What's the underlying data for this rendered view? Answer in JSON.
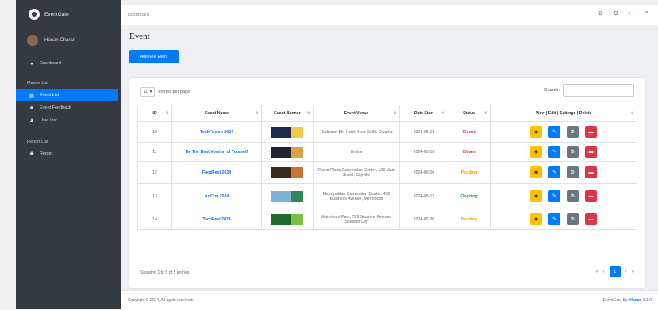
{
  "brand": {
    "name": "EventGate"
  },
  "user": {
    "name": "Hanan Charan"
  },
  "nav": {
    "dashboard": "Dashboard",
    "section1": "Master List",
    "items1": [
      {
        "label": "Event List",
        "icon": "calendar-icon",
        "active": true
      },
      {
        "label": "Event Feedback",
        "icon": "users-icon",
        "active": false
      },
      {
        "label": "User List",
        "icon": "user-icon",
        "active": false
      }
    ],
    "section2": "Report List",
    "items2": [
      {
        "label": "Report",
        "icon": "gear-icon"
      }
    ]
  },
  "topbar": {
    "breadcrumb": "Dashboard",
    "icons": [
      "grid-icon",
      "gear-icon",
      "logout-icon",
      "menu-icon"
    ]
  },
  "page": {
    "title": "Event",
    "add_button": "Add New Event"
  },
  "table": {
    "length_value": "10",
    "length_label": "entries per page",
    "search_label": "Search:",
    "columns": [
      "ID",
      "Event Name",
      "Event Banner",
      "Event Venue",
      "Date Start",
      "Status",
      "View | Edit | Settings | Delete"
    ],
    "rows": [
      {
        "id": "10",
        "name": "TechFusion 2024",
        "venue": "Radisson Blu Hotel, New Delhi, Dwarka",
        "date": "2024-05-18",
        "status": "Closed",
        "status_color": "#dc3545",
        "banner_colors": [
          "#1e2a4a",
          "#f2c94c"
        ]
      },
      {
        "id": "11",
        "name": "Be The Best Version of Yourself",
        "venue": "Online",
        "date": "2024-05-18",
        "status": "Closed",
        "status_color": "#dc3545",
        "banner_colors": [
          "#20242c",
          "#d9a441"
        ]
      },
      {
        "id": "12",
        "name": "FoodFest 2024",
        "venue": "Grand Plaza Convention Center, 123 Main Street, Cityville",
        "date": "2024-06-06",
        "status": "Pending",
        "status_color": "#fd9f17",
        "banner_colors": [
          "#3b2a1a",
          "#c7742e"
        ]
      },
      {
        "id": "13",
        "name": "ArtCon 2024",
        "venue": "Metropolitan Convention Center, 456 Business Avenue, Metropolis",
        "date": "2024-05-12",
        "status": "Ongoing",
        "status_color": "#28a745",
        "banner_colors": [
          "#7fb3d5",
          "#2e8b57"
        ]
      },
      {
        "id": "14",
        "name": "TechFest 2024",
        "venue": "Waterfront Park, 789 Seaview Avenue, Seaside City",
        "date": "2024-05-30",
        "status": "Pending",
        "status_color": "#fd9f17",
        "banner_colors": [
          "#1f6b2e",
          "#7bc043"
        ]
      }
    ]
  },
  "info": "Showing 1 to 5 of 5 entries",
  "pager": {
    "prev2": "«",
    "prev": "‹",
    "current": "1",
    "next": "›",
    "next2": "»"
  },
  "footer": {
    "left": "Copyright © 2024, All rights reserved.",
    "right_prefix": "EventGate By:",
    "right_link": "Hanan",
    "version": "3.1.0"
  }
}
